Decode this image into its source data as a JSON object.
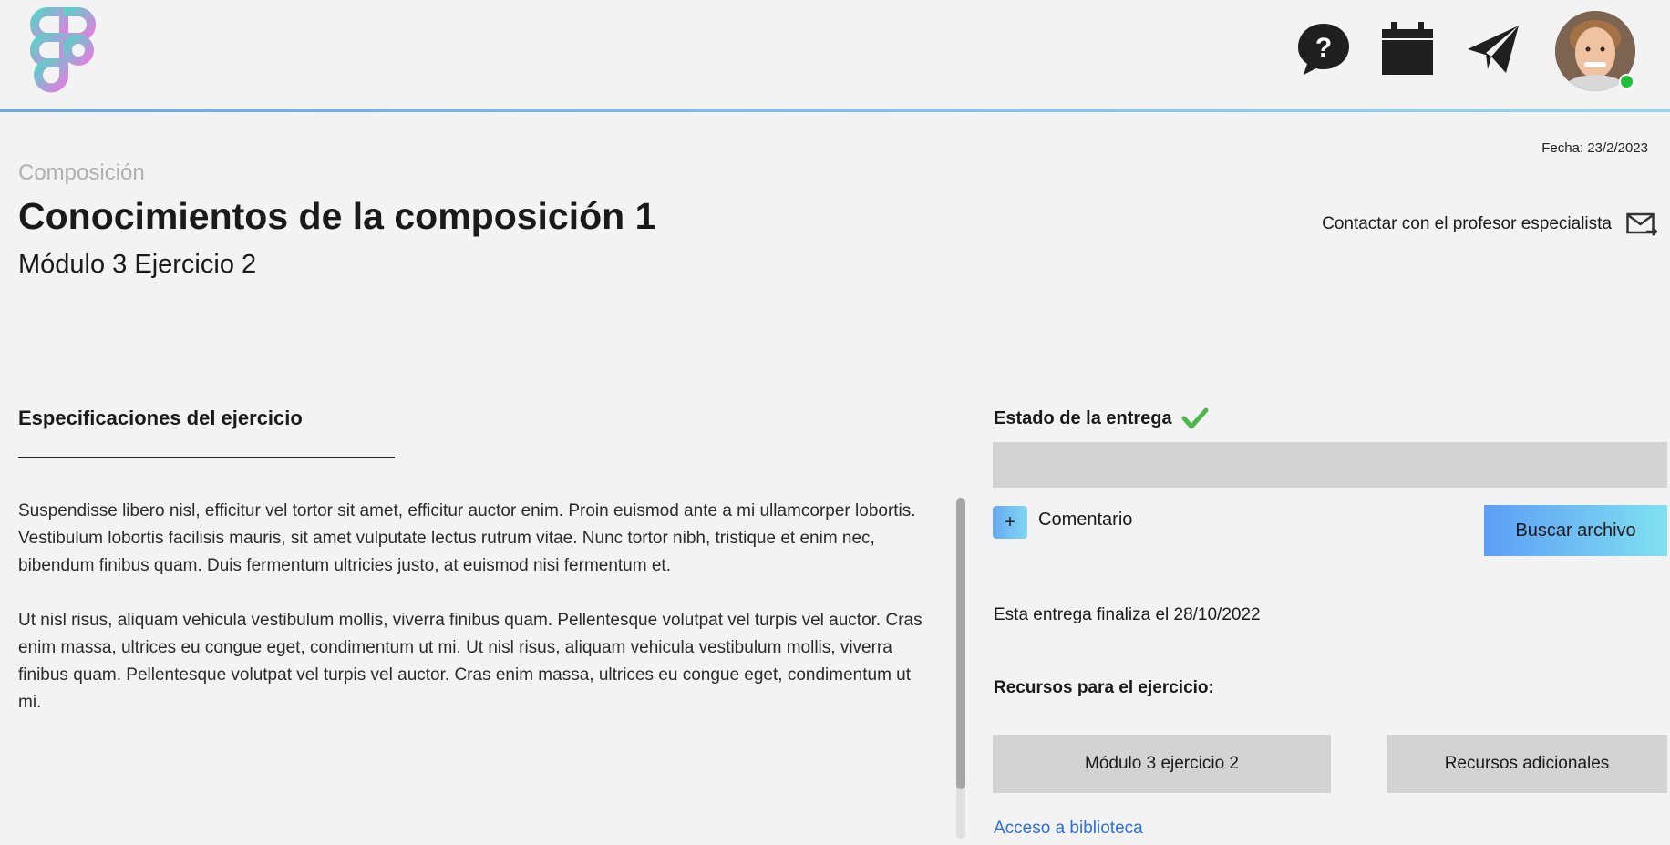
{
  "header": {
    "help_icon": "help-bubble-icon",
    "calendar_icon": "calendar-icon",
    "messages_icon": "paper-plane-icon",
    "avatar": "user-avatar",
    "online": true,
    "accent_gradient": [
      "#6aa6f0",
      "#8fd8f4"
    ]
  },
  "page": {
    "date": "Fecha: 23/2/2023",
    "subject": "Composición",
    "title": "Conocimientos de la composición 1",
    "subtitle": "Módulo 3 Ejercicio 2",
    "contact_label": "Contactar con el profesor especialista"
  },
  "spec": {
    "title": "Especificaciones del ejercicio",
    "paragraphs": [
      "Suspendisse libero nisl, efficitur vel tortor sit amet, efficitur auctor enim. Proin euismod ante a mi ullamcorper lobortis. Vestibulum lobortis facilisis mauris, sit amet vulputate lectus rutrum vitae. Nunc tortor nibh, tristique et enim nec, bibendum finibus quam. Duis fermentum ultricies justo, at euismod nisi fermentum et.",
      "Ut nisl risus, aliquam vehicula vestibulum mollis, viverra finibus quam. Pellentesque volutpat vel turpis vel auctor. Cras enim massa, ultrices eu congue eget, condimentum ut mi. Ut nisl risus, aliquam vehicula vestibulum mollis, viverra finibus quam. Pellentesque volutpat vel turpis vel auctor. Cras enim massa, ultrices eu congue eget, condimentum ut mi."
    ]
  },
  "delivery": {
    "status_title": "Estado de la entrega",
    "status_icon": "check-icon",
    "status_color": "#4fb84a",
    "comment_icon": "+",
    "comment_label": "Comentario",
    "browse_label": "Buscar archivo",
    "deadline": "Esta entrega finaliza el 28/10/2022",
    "resources_title": "Recursos para el ejercicio:",
    "resource_1": "Módulo 3 ejercicio 2",
    "resource_2": "Recursos adicionales",
    "library_link": "Acceso a biblioteca"
  }
}
